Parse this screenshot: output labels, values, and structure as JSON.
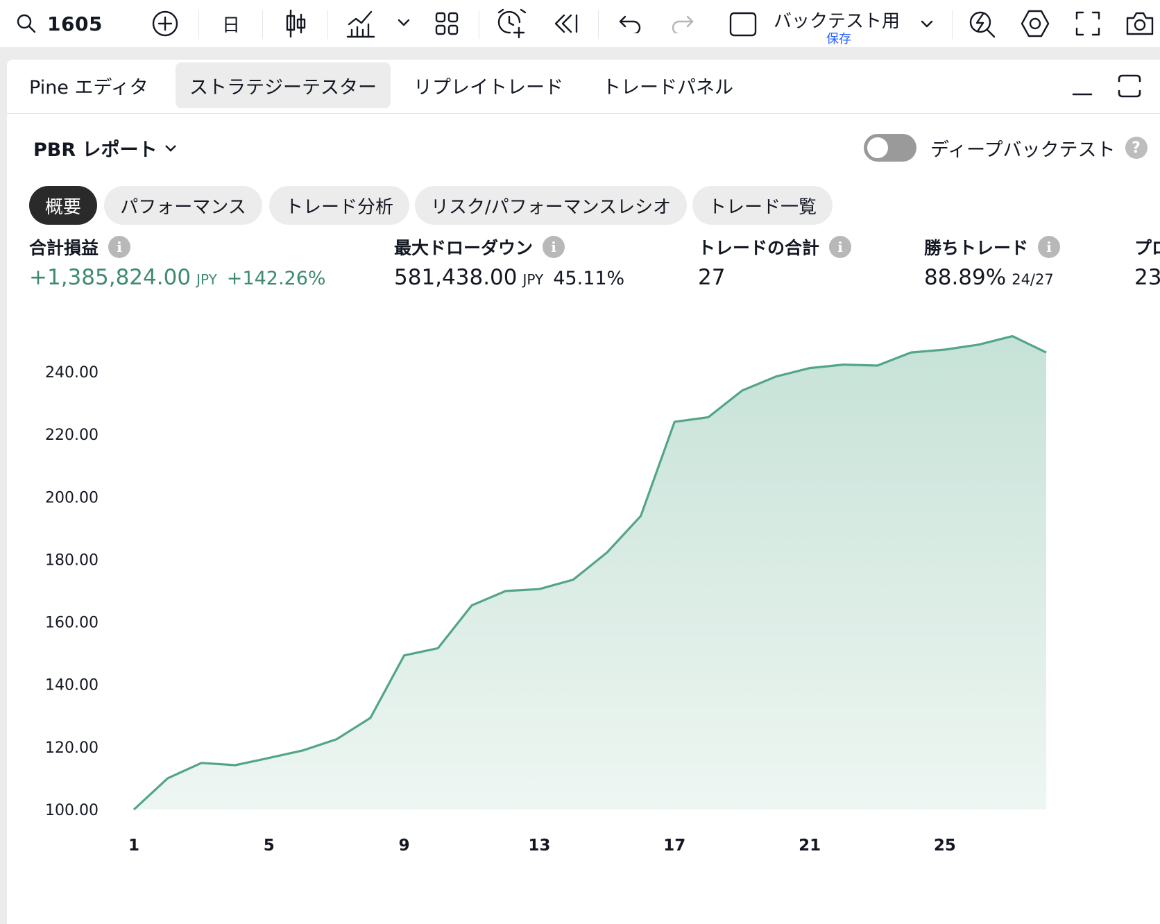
{
  "toolbar": {
    "symbol": "1605",
    "interval": "日",
    "layout_name": "バックテスト用",
    "layout_status": "保存",
    "icons": [
      "search-icon",
      "add-symbol-icon",
      "candles-icon",
      "indicators-icon",
      "chevron-down-icon",
      "layouts-icon",
      "alert-icon",
      "replay-icon",
      "undo-icon",
      "redo-icon",
      "layout-box-icon",
      "quick-search-icon",
      "settings-icon",
      "fullscreen-icon",
      "camera-icon"
    ]
  },
  "panel": {
    "tabs": [
      {
        "label": "Pine エディタ",
        "active": false
      },
      {
        "label": "ストラテジーテスター",
        "active": true
      },
      {
        "label": "リプレイトレード",
        "active": false
      },
      {
        "label": "トレードパネル",
        "active": false
      }
    ],
    "report_title": "PBR レポート",
    "deep_backtest_label": "ディープバックテスト",
    "deep_backtest_on": false,
    "help_glyph": "?",
    "subtabs": [
      {
        "label": "概要",
        "active": true
      },
      {
        "label": "パフォーマンス",
        "active": false
      },
      {
        "label": "トレード分析",
        "active": false
      },
      {
        "label": "リスク/パフォーマンスレシオ",
        "active": false
      },
      {
        "label": "トレード一覧",
        "active": false
      }
    ],
    "info_glyph": "i"
  },
  "metrics": {
    "net_profit": {
      "label": "合計損益",
      "value": "+1,385,824.00",
      "unit": "JPY",
      "pct": "+142.26%"
    },
    "max_drawdown": {
      "label": "最大ドローダウン",
      "value": "581,438.00",
      "unit": "JPY",
      "pct": "45.11%"
    },
    "total_trades": {
      "label": "トレードの合計",
      "value": "27"
    },
    "win_trades": {
      "label": "勝ちトレード",
      "value": "88.89%",
      "sub": "24/27"
    },
    "cut_off": {
      "label": "プロ",
      "value": "23"
    }
  },
  "colors": {
    "accent_green": "#3d8b6e",
    "line": "#52a58b",
    "fill": "#d2e8df",
    "active_pill": "#2a2a2a",
    "layout_status_blue": "#2962ff"
  },
  "chart_data": {
    "type": "area",
    "x": [
      1,
      2,
      3,
      4,
      5,
      6,
      7,
      8,
      9,
      10,
      11,
      12,
      13,
      14,
      15,
      16,
      17,
      18,
      19,
      20,
      21,
      22,
      23,
      24,
      25,
      26,
      27,
      28
    ],
    "values": [
      100.0,
      110.0,
      114.9,
      114.2,
      116.5,
      118.9,
      122.5,
      129.3,
      149.3,
      151.6,
      165.3,
      169.9,
      170.5,
      173.5,
      182.2,
      193.9,
      224.0,
      225.5,
      234.0,
      238.5,
      241.2,
      242.3,
      242.0,
      246.2,
      247.1,
      248.7,
      251.4,
      246.2
    ],
    "yticks": [
      "100.00",
      "120.00",
      "140.00",
      "160.00",
      "180.00",
      "200.00",
      "220.00",
      "240.00"
    ],
    "xticks": [
      "1",
      "5",
      "9",
      "13",
      "17",
      "21",
      "25"
    ],
    "ylim": [
      100,
      260
    ],
    "xlabel": "",
    "ylabel": ""
  }
}
